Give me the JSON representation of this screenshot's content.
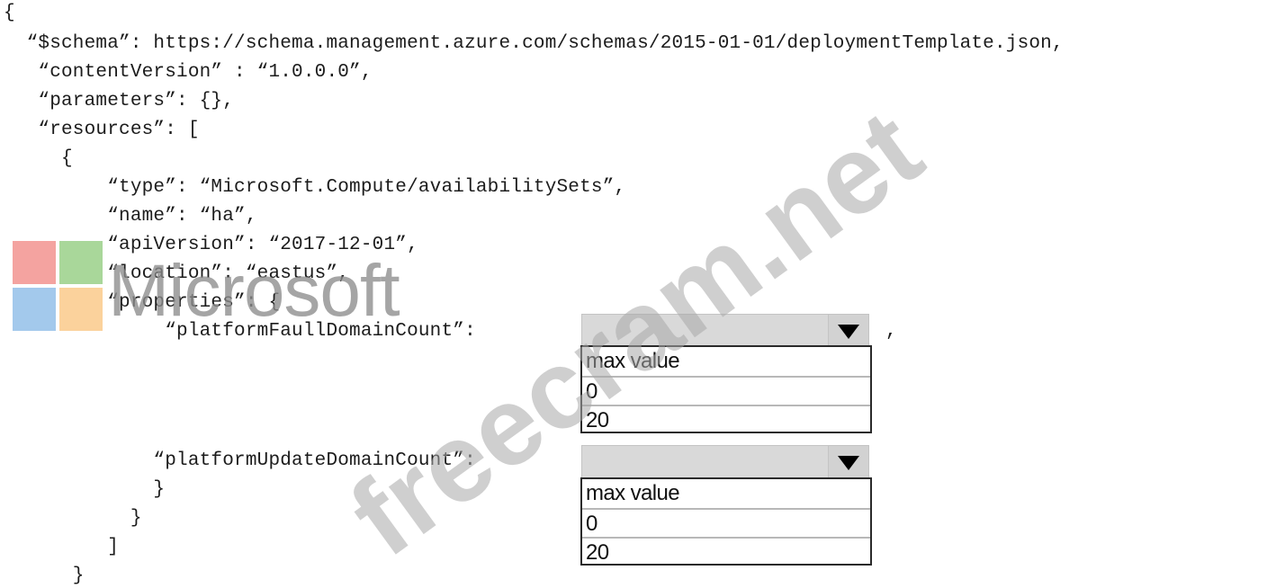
{
  "code_lines": [
    "{",
    "  “$schema”: https://schema.management.azure.com/schemas/2015-01-01/deploymentTemplate.json,",
    "   “contentVersion” : “1.0.0.0”,",
    "   “parameters”: {},",
    "   “resources”: [",
    "     {",
    "         “type”: “Microsoft.Compute/availabilitySets”,",
    "         “name”: “ha”,",
    "         “apiVersion”: “2017-12-01”,",
    "         “location”: “eastus”,",
    "         “properties”: {",
    "              “platformFaullDomainCount”:",
    "             “platformUpdateDomainCount”:",
    "             }",
    "           }",
    "         ]",
    "      }"
  ],
  "trailing_comma": ",",
  "dropdowns": [
    {
      "label": "platformFaullDomainCount",
      "selected": "",
      "options": [
        "max value",
        "0",
        "20"
      ]
    },
    {
      "label": "platformUpdateDomainCount",
      "selected": "",
      "options": [
        "max value",
        "0",
        "20"
      ]
    }
  ],
  "logo": {
    "word": "Microsoft",
    "colors": [
      "#f4a3a0",
      "#a9d79a",
      "#a3c9ec",
      "#fbd29c"
    ]
  },
  "watermark": "freecram.net",
  "icons": {
    "dropdown_arrow": "triangle-down-icon"
  }
}
